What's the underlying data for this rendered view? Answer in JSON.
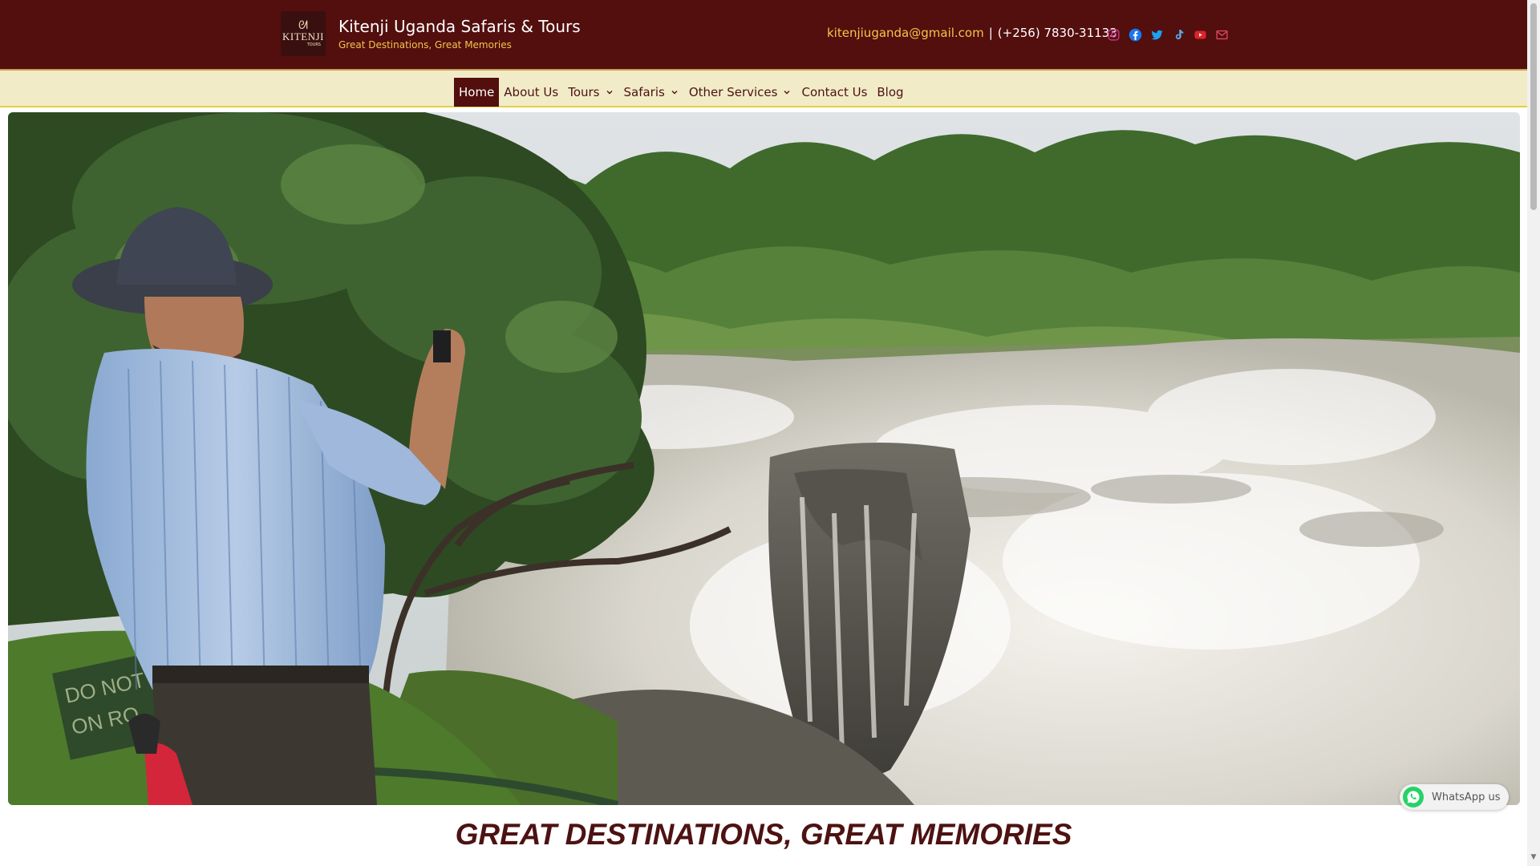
{
  "header": {
    "site_title": "Kitenji Uganda Safaris & Tours",
    "tagline": "Great Destinations, Great Memories",
    "logo_text": "KITENJI",
    "logo_subtext": "TOURS",
    "email": "kitenjiuganda@gmail.com",
    "separator": "|",
    "phone": "(+256) 7830-31133",
    "socials": [
      "instagram-icon",
      "facebook-icon",
      "twitter-icon",
      "tiktok-icon",
      "youtube-icon",
      "email-icon"
    ]
  },
  "nav": {
    "items": [
      {
        "label": "Home",
        "active": true
      },
      {
        "label": "About Us"
      },
      {
        "label": "Tours",
        "dropdown": true
      },
      {
        "label": "Safaris",
        "dropdown": true
      },
      {
        "label": "Other Services",
        "dropdown": true
      },
      {
        "label": "Contact Us"
      },
      {
        "label": "Blog"
      }
    ]
  },
  "hero": {
    "sign_text_1": "DO NOT LE",
    "sign_text_2": "ON RO"
  },
  "main": {
    "heading": "GREAT DESTINATIONS, GREAT MEMORIES"
  },
  "whatsapp": {
    "label": "WhatsApp us"
  },
  "colors": {
    "maroon": "#530e0e",
    "gold": "#f2c64a",
    "nav_bg": "#f1ecc7",
    "nav_underline": "#e3cf4a",
    "heading": "#4d1212",
    "whatsapp_green": "#25d366"
  }
}
